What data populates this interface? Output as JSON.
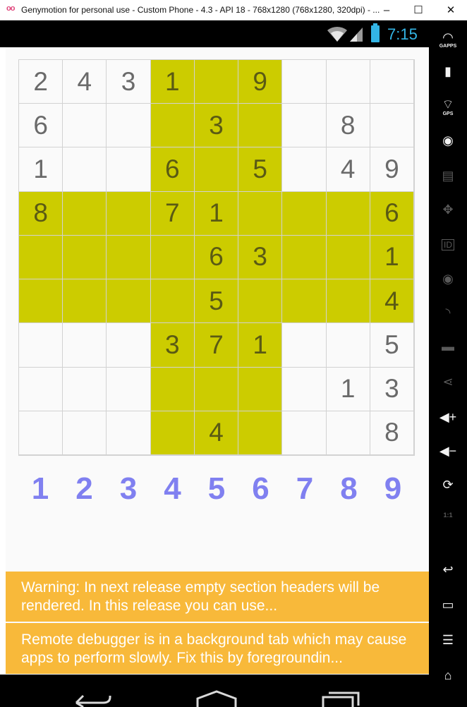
{
  "window": {
    "logo": "oo",
    "title": "Genymotion for personal use - Custom Phone - 4.3 - API 18 - 768x1280 (768x1280, 320dpi) - ...",
    "minimize": "–",
    "maximize": "☐",
    "close": "✕"
  },
  "status_bar": {
    "time": "7:15"
  },
  "sidebar": {
    "gapps_label": "GAPPS",
    "gps_label": "GPS",
    "id_label": "ID",
    "pixel_label": "1:1"
  },
  "sudoku": {
    "highlight_color": "#cccc00",
    "rows": [
      [
        "2",
        "4",
        "3",
        "1",
        "",
        "9",
        "",
        "",
        ""
      ],
      [
        "6",
        "",
        "",
        "",
        "3",
        "",
        "",
        "8",
        ""
      ],
      [
        "1",
        "",
        "",
        "6",
        "",
        "5",
        "",
        "4",
        "9"
      ],
      [
        "8",
        "",
        "",
        "7",
        "1",
        "",
        "",
        "",
        "6"
      ],
      [
        "",
        "",
        "",
        "",
        "6",
        "3",
        "",
        "",
        "1"
      ],
      [
        "",
        "",
        "",
        "",
        "5",
        "",
        "",
        "",
        "4"
      ],
      [
        "",
        "",
        "",
        "3",
        "7",
        "1",
        "",
        "",
        "5"
      ],
      [
        "",
        "",
        "",
        "",
        "",
        "",
        "",
        "1",
        "3"
      ],
      [
        "",
        "",
        "",
        "",
        "4",
        "",
        "",
        "",
        "8"
      ]
    ],
    "highlight": [
      [
        0,
        0,
        0,
        1,
        1,
        1,
        0,
        0,
        0
      ],
      [
        0,
        0,
        0,
        1,
        1,
        1,
        0,
        0,
        0
      ],
      [
        0,
        0,
        0,
        1,
        1,
        1,
        0,
        0,
        0
      ],
      [
        1,
        1,
        1,
        1,
        1,
        1,
        1,
        1,
        1
      ],
      [
        1,
        1,
        1,
        1,
        1,
        1,
        1,
        1,
        1
      ],
      [
        1,
        1,
        1,
        1,
        1,
        1,
        1,
        1,
        1
      ],
      [
        0,
        0,
        0,
        1,
        1,
        1,
        0,
        0,
        0
      ],
      [
        0,
        0,
        0,
        1,
        1,
        1,
        0,
        0,
        0
      ],
      [
        0,
        0,
        0,
        1,
        1,
        1,
        0,
        0,
        0
      ]
    ]
  },
  "number_picker": [
    "1",
    "2",
    "3",
    "4",
    "5",
    "6",
    "7",
    "8",
    "9"
  ],
  "warnings": {
    "first": "Warning: In next release empty section headers will be rendered. In this release you can use...",
    "second": "Remote debugger is in a background tab which may cause apps to perform slowly. Fix this by foregroundin..."
  }
}
